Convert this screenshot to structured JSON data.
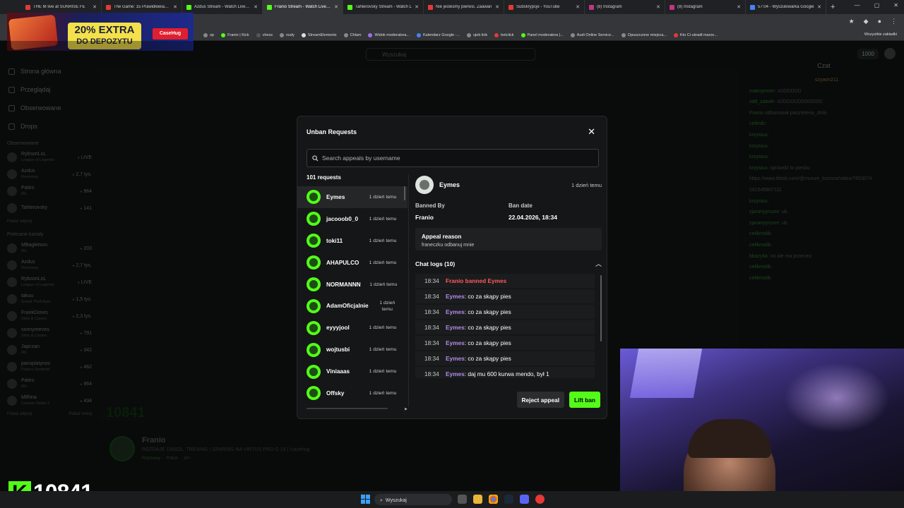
{
  "browser": {
    "tabs": [
      {
        "title": "THE M live at SUNRISE FE",
        "color": "#e53935"
      },
      {
        "title": "The Game: 15 Prawidłowiaków",
        "color": "#e53935"
      },
      {
        "title": "Azdus Stream - Watch Live on",
        "color": "#53fc18"
      },
      {
        "title": "Franio Stream - Watch Live on",
        "color": "#53fc18"
      },
      {
        "title": "Tahlerovsky Stream - Watch L",
        "color": "#53fc18"
      },
      {
        "title": "Nie jesteśmy pierwsi. Zaawan",
        "color": "#e53935"
      },
      {
        "title": "Subskrypcje - YouTube",
        "color": "#e53935"
      },
      {
        "title": "(8) Instagram",
        "color": "#c13584"
      },
      {
        "title": "(8) Instagram",
        "color": "#c13584"
      },
      {
        "title": "57:04 - Wyszukiwarka Google",
        "color": "#4285f4"
      }
    ],
    "bookmarks": [
      {
        "label": "op"
      },
      {
        "label": "Franio | Kick"
      },
      {
        "label": "chess"
      },
      {
        "label": "nudy"
      },
      {
        "label": "StreamElements"
      },
      {
        "label": "Chłam"
      },
      {
        "label": "Widok moderatora..."
      },
      {
        "label": "Kalendarz Google -..."
      },
      {
        "label": "ujeb link"
      },
      {
        "label": "betclick"
      },
      {
        "label": "Panel moderatora |..."
      },
      {
        "label": "Audi Online Service..."
      },
      {
        "label": "Opuszczone miejsca..."
      },
      {
        "label": "Kto Ci ukradł marze..."
      }
    ],
    "bookmarks_all": "Wszystkie zakładki"
  },
  "promo": {
    "line1": "20% EXTRA",
    "line2": "DO DEPOZYTU",
    "brand": "CaseHug"
  },
  "topnav": {
    "search_placeholder": "Wyszukaj",
    "points": "1000"
  },
  "sidebar": {
    "nav": [
      "Strona główna",
      "Przeglądaj",
      "Obserwowane",
      "Drops"
    ],
    "followed_header": "Obserwowane",
    "followed": [
      {
        "name": "RybsonLoL",
        "game": "League of Legends",
        "viewers": "LIVE"
      },
      {
        "name": "Azdus",
        "game": "Rozmowy",
        "viewers": "2,7 tys."
      },
      {
        "name": "Patiro",
        "game": "IRL",
        "viewers": "964"
      },
      {
        "name": "Tahlerovsky",
        "game": "",
        "viewers": "141"
      }
    ],
    "show_more": "Pokaż więcej",
    "recommended_header": "Polecane kanały",
    "recommended": [
      {
        "name": "MBagletson",
        "game": "IRL",
        "viewers": "203"
      },
      {
        "name": "Azdus",
        "game": "Rozmowy",
        "viewers": "2,7 tys."
      },
      {
        "name": "RybsonLoL",
        "game": "League of Legends",
        "viewers": "LIVE"
      },
      {
        "name": "takuu",
        "game": "Grand Theft Auto",
        "viewers": "1,5 tys."
      },
      {
        "name": "FrankDimes",
        "game": "Slots & Casino",
        "viewers": "2,3 tys."
      },
      {
        "name": "sonnyreeves",
        "game": "Slots & Casino",
        "viewers": "791"
      },
      {
        "name": "Japczan",
        "game": "IRL",
        "viewers": "342"
      },
      {
        "name": "parisplatynov",
        "game": "Project Zomboid",
        "viewers": "462"
      },
      {
        "name": "Patiro",
        "game": "IRL",
        "viewers": "964"
      },
      {
        "name": "MlRina",
        "game": "Counter-Strike 2",
        "viewers": "434"
      }
    ],
    "show_more2": "Pokaż więcej",
    "show_less": "Pokaż mniej"
  },
  "stream": {
    "name": "Franio",
    "title": "ROZDAJE 1500ZŁ, TRENING I SPARING NA VIRTUS PRO O 19 | !casehug",
    "tags": [
      "Rozmowy",
      "Polish",
      "18+"
    ],
    "overlay_number": "10841"
  },
  "chat": {
    "title": "Czat",
    "pinned": "szyaon211",
    "lines": [
      {
        "user": "maksymser",
        "msg": ": xDDDDDD"
      },
      {
        "user": "xdd_zakole",
        "msg": ": xDDDDDDDDDDDD"
      },
      {
        "user": "Franio",
        "msg": " odbanował paszteteva_ztnki"
      },
      {
        "user": "ceilmilc",
        "msg": ":"
      },
      {
        "user": "krzysiuu",
        "msg": ":"
      },
      {
        "user": "krzysiuu",
        "msg": ":"
      },
      {
        "user": "krzysiuu",
        "msg": ":"
      },
      {
        "user": "krzysiuu",
        "msg": ": sprawdź to piesku"
      },
      {
        "user": "",
        "msg": "https://www.tiktok.com/@munze_koonza/video/7653074"
      },
      {
        "user": "",
        "msg": "181545807111"
      },
      {
        "user": "krzysiuu",
        "msg": ":"
      },
      {
        "user": "zjaranyyrcure",
        "msg": ": ub"
      },
      {
        "user": "zjaranyyrcure",
        "msg": ": ub"
      },
      {
        "user": "",
        "msg": ""
      },
      {
        "user": "",
        "msg": ""
      },
      {
        "user": "",
        "msg": ""
      },
      {
        "user": "ceilkmolik",
        "msg": ":"
      },
      {
        "user": "ceilkmolik",
        "msg": ":"
      },
      {
        "user": "bbazylia",
        "msg": ": no ale ma przecież"
      },
      {
        "user": "ceilkmolik",
        "msg": ":"
      },
      {
        "user": "ceilkmolik",
        "msg": ":"
      }
    ]
  },
  "modal": {
    "title": "Unban Requests",
    "search_placeholder": "Search appeals by username",
    "count": "101 requests",
    "requests": [
      {
        "name": "Eymes",
        "time": "1 dzień temu",
        "selected": true
      },
      {
        "name": "jacooob0_0",
        "time": "1 dzień temu"
      },
      {
        "name": "toki11",
        "time": "1 dzień temu"
      },
      {
        "name": "AHAPULCO",
        "time": "1 dzień temu"
      },
      {
        "name": "NORMANNN",
        "time": "1 dzień temu"
      },
      {
        "name": "AdamOficjalnie",
        "time": "1 dzień temu"
      },
      {
        "name": "eyyyjool",
        "time": "1 dzień temu"
      },
      {
        "name": "wojtusbi",
        "time": "1 dzień temu"
      },
      {
        "name": "Viniaaas",
        "time": "1 dzień temu"
      },
      {
        "name": "Offsky",
        "time": "1 dzień temu"
      }
    ],
    "detail": {
      "name": "Eymes",
      "time": "1 dzień temu",
      "banned_by_label": "Banned By",
      "banned_by": "Franio",
      "ban_date_label": "Ban date",
      "ban_date": "22.04.2026, 18:34",
      "appeal_label": "Appeal reason",
      "appeal_text": "franeczku odbanuj mnie",
      "logs_label": "Chat logs (10)",
      "logs": [
        {
          "time": "18:34",
          "user": "Franio banned Eymes",
          "msg": "",
          "ban": true
        },
        {
          "time": "18:34",
          "user": "Eymes",
          "msg": ": co za skąpy pies"
        },
        {
          "time": "18:34",
          "user": "Eymes",
          "msg": ": co za skąpy pies"
        },
        {
          "time": "18:34",
          "user": "Eymes",
          "msg": ": co za skąpy pies"
        },
        {
          "time": "18:34",
          "user": "Eymes",
          "msg": ": co za skąpy pies"
        },
        {
          "time": "18:34",
          "user": "Eymes",
          "msg": ": co za skąpy pies"
        },
        {
          "time": "18:34",
          "user": "Eymes",
          "msg": ": daj mu 600 kurwa mendo, był 1"
        }
      ]
    },
    "reject_label": "Reject appeal",
    "lift_label": "Lift ban"
  },
  "taskbar": {
    "search": "Wyszukaj"
  },
  "colors": {
    "kick_green": "#53fc18",
    "username_purple": "#b48ce8",
    "ban_red": "#ff5a5a"
  }
}
